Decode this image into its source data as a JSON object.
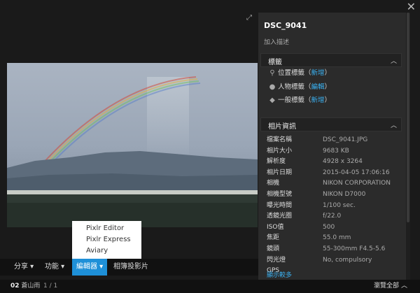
{
  "viewer": {
    "menu_buttons": [
      {
        "label": "分享 ▾"
      },
      {
        "label": "功能 ▾"
      },
      {
        "label": "編輯器 ▾"
      },
      {
        "label": "相簿投影片"
      }
    ],
    "editor_menu": [
      "Pixlr Editor",
      "Pixlr Express",
      "Aviary"
    ]
  },
  "footer": {
    "album_index": "02",
    "album_name": "蒼山雨",
    "counter": "1 / 1",
    "browse_all": "瀏覽全部"
  },
  "panel": {
    "title": "DSC_9041",
    "description_placeholder": "加入描述",
    "tags_header": "標籤",
    "tags": [
      {
        "icon": "location-icon",
        "label": "位置標籤（",
        "action": "新增",
        "end": "）"
      },
      {
        "icon": "person-icon",
        "label": "人物標籤（",
        "action": "編輯",
        "end": "）"
      },
      {
        "icon": "tag-icon",
        "label": "一般標籤（",
        "action": "新增",
        "end": "）"
      }
    ],
    "info_header": "相片資訊",
    "info": [
      {
        "k": "檔案名稱",
        "v": "DSC_9041.JPG"
      },
      {
        "k": "相片大小",
        "v": "9683 KB"
      },
      {
        "k": "解析度",
        "v": "4928 x 3264"
      },
      {
        "k": "相片日期",
        "v": "2015-04-05 17:06:16"
      },
      {
        "k": "相機",
        "v": "NIKON CORPORATION"
      },
      {
        "k": "相機型號",
        "v": "NIKON D7000"
      },
      {
        "k": "曝光時間",
        "v": "1/100 sec."
      },
      {
        "k": "透鏡光圈",
        "v": "f/22.0"
      },
      {
        "k": "ISO值",
        "v": "500"
      },
      {
        "k": "焦距",
        "v": "55.0 mm"
      },
      {
        "k": "鏡頭",
        "v": "55-300mm F4.5-5.6"
      },
      {
        "k": "閃光燈",
        "v": "No, compulsory"
      },
      {
        "k": "GPS",
        "v": ""
      }
    ],
    "show_more": "顯示較多"
  },
  "colors": {
    "accent": "#1e90d8",
    "link": "#3ab0f0",
    "panel_bg": "#2b2b2b"
  }
}
